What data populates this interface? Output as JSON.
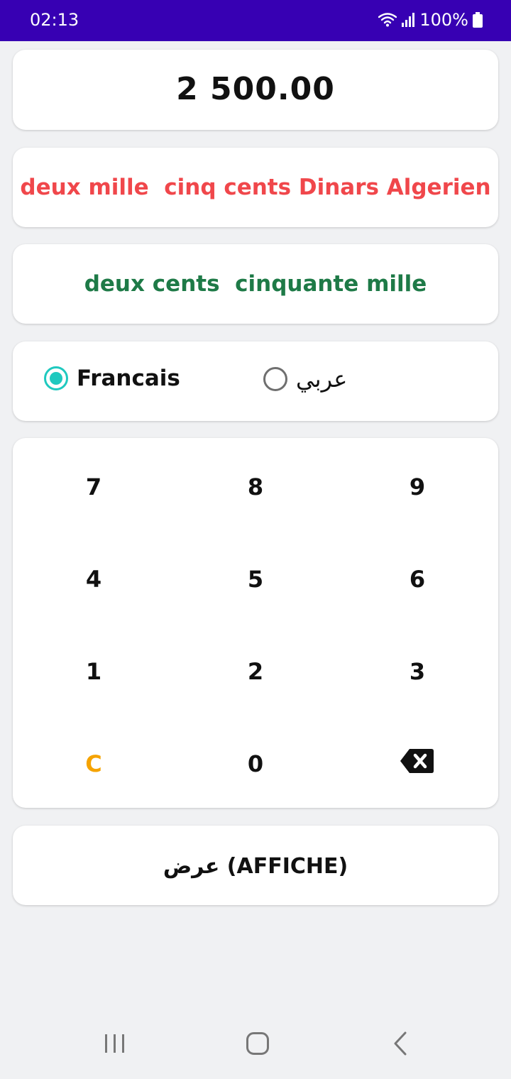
{
  "status_bar": {
    "time": "02:13",
    "battery": "100%",
    "icons": [
      "wifi-icon",
      "signal-icon",
      "battery-icon"
    ]
  },
  "display": {
    "value": "2 500.00"
  },
  "words": {
    "french_currency": "deux mille  cinq cents Dinars Algerien",
    "french_secondary": "deux cents  cinquante mille"
  },
  "language": {
    "options": [
      {
        "label": "Francais",
        "selected": true
      },
      {
        "label": "عربي",
        "selected": false
      }
    ]
  },
  "keypad": {
    "keys": [
      "7",
      "8",
      "9",
      "4",
      "5",
      "6",
      "1",
      "2",
      "3",
      "C",
      "0",
      "backspace-icon"
    ]
  },
  "show_button": {
    "label": "عرض (AFFICHE)"
  },
  "nav_bar": {
    "icons": [
      "recent-apps-icon",
      "home-icon",
      "back-icon"
    ]
  },
  "colors": {
    "status_bar": "#3700b3",
    "french_currency_text": "#f0474b",
    "secondary_text": "#1e7a47",
    "radio_accent": "#1fc9bf",
    "clear_key": "#f5a300",
    "background": "#f0f1f3"
  }
}
